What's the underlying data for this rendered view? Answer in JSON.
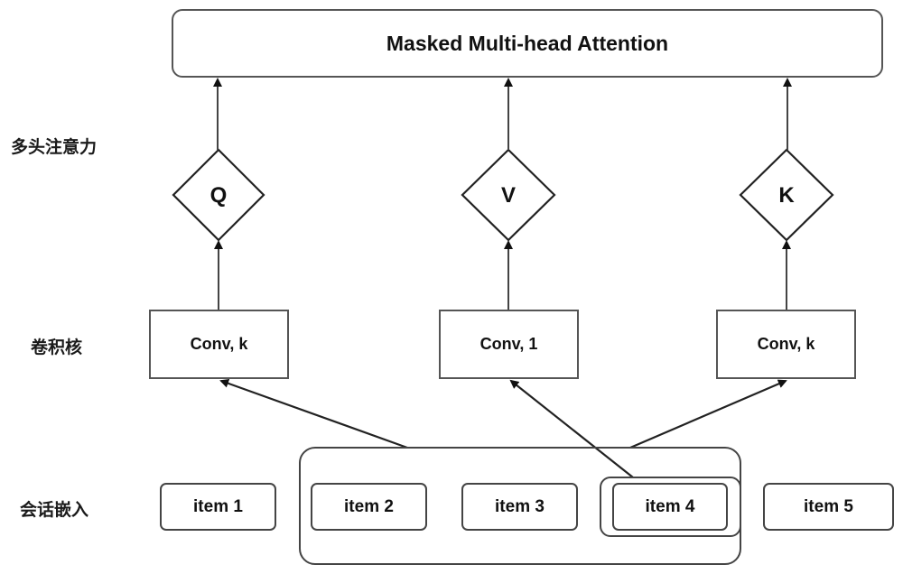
{
  "title": "Masked Multi-head Attention",
  "row_labels": {
    "attention": "多头注意力",
    "conv": "卷积核",
    "embedding": "会话嵌入"
  },
  "diamonds": [
    {
      "label": "Q"
    },
    {
      "label": "V"
    },
    {
      "label": "K"
    }
  ],
  "conv_boxes": [
    {
      "label": "Conv, k"
    },
    {
      "label": "Conv, 1"
    },
    {
      "label": "Conv, k"
    }
  ],
  "items": [
    {
      "label": "item 1"
    },
    {
      "label": "item 2"
    },
    {
      "label": "item 3"
    },
    {
      "label": "item 4"
    },
    {
      "label": "item 5"
    }
  ],
  "colors": {
    "stroke": "#333333",
    "background": "#ffffff"
  }
}
